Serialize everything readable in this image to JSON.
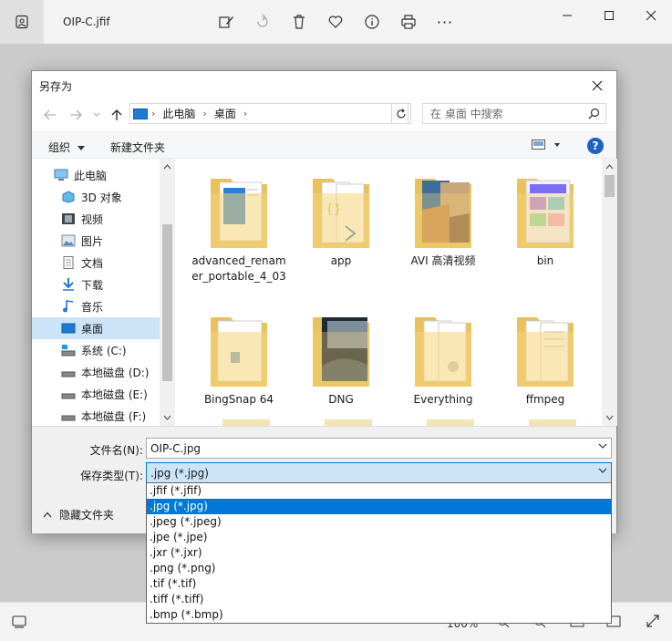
{
  "viewer": {
    "title": "OIP-C.jfif",
    "zoom": "100%",
    "toolbar_icons": [
      "edit-icon",
      "rotate-icon",
      "delete-icon",
      "favorite-icon",
      "info-icon",
      "print-icon",
      "more-icon"
    ],
    "more_label": "···"
  },
  "dialog": {
    "title": "另存为",
    "address": {
      "crumbs": [
        "此电脑",
        "桌面"
      ]
    },
    "search": {
      "placeholder": "在 桌面 中搜索"
    },
    "toolbar": {
      "organize": "组织",
      "new_folder": "新建文件夹"
    },
    "help_label": "?",
    "sidebar": [
      {
        "label": "此电脑",
        "icon": "computer-icon"
      },
      {
        "label": "3D 对象",
        "icon": "3d-objects-icon"
      },
      {
        "label": "视频",
        "icon": "video-icon"
      },
      {
        "label": "图片",
        "icon": "pictures-icon"
      },
      {
        "label": "文档",
        "icon": "documents-icon"
      },
      {
        "label": "下载",
        "icon": "download-icon"
      },
      {
        "label": "音乐",
        "icon": "music-icon"
      },
      {
        "label": "桌面",
        "icon": "desktop-icon",
        "selected": true
      },
      {
        "label": "系统 (C:)",
        "icon": "drive-c-icon"
      },
      {
        "label": "本地磁盘 (D:)",
        "icon": "drive-icon"
      },
      {
        "label": "本地磁盘 (E:)",
        "icon": "drive-icon"
      },
      {
        "label": "本地磁盘 (F:)",
        "icon": "drive-icon"
      }
    ],
    "files": [
      {
        "name": "advanced_renamer_portable_4_03"
      },
      {
        "name": "app"
      },
      {
        "name": "AVI 高清视频"
      },
      {
        "name": "bin"
      },
      {
        "name": "BingSnap 64"
      },
      {
        "name": "DNG"
      },
      {
        "name": "Everything"
      },
      {
        "name": "ffmpeg"
      }
    ],
    "filename": {
      "label": "文件名(N):",
      "value": "OIP-C.jpg"
    },
    "filetype": {
      "label": "保存类型(T):",
      "value": ".jpg (*.jpg)"
    },
    "hide_folders": "隐藏文件夹",
    "filetype_options": [
      ".jfif (*.jfif)",
      ".jpg (*.jpg)",
      ".jpeg (*.jpeg)",
      ".jpe (*.jpe)",
      ".jxr (*.jxr)",
      ".png (*.png)",
      ".tif (*.tif)",
      ".tiff (*.tiff)",
      ".bmp (*.bmp)"
    ],
    "selected_option_index": 1
  },
  "colors": {
    "accent": "#0078d7",
    "selection": "#cce4f7",
    "folder": "#f6d47a"
  }
}
